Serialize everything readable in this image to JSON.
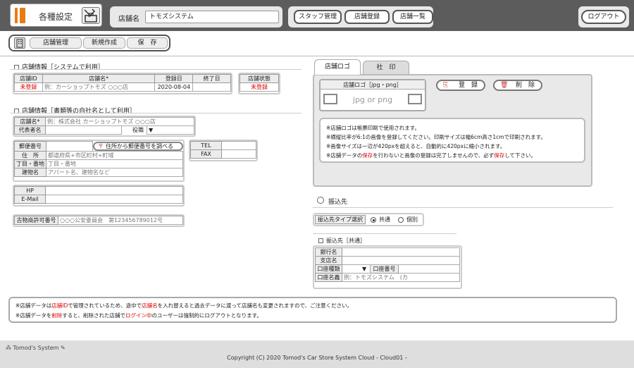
{
  "header": {
    "title": "各種設定",
    "store_label": "店舗名",
    "store_value": "トモズシステム",
    "nav": [
      "スタッフ管理",
      "店舗登録",
      "店舗一覧"
    ],
    "logout": "ログアウト"
  },
  "toolbar": {
    "items": [
      "店舗管理",
      "新規作成",
      "保　存"
    ]
  },
  "sys_info": {
    "title": "店舗情報［システムで利用］",
    "headers": [
      "店舗ID",
      "店舗名*",
      "登録日",
      "終了日"
    ],
    "values": [
      "未登録",
      "例：カーショップトモズ ○○○店",
      "2020-08-04",
      ""
    ],
    "status_header": "店舗状態",
    "status_value": "未登録"
  },
  "doc_info": {
    "title": "店舗情報［書類等の自社名として利用］",
    "store_name_label": "店舗名*",
    "store_name_placeholder": "例：株式会社 カーショップトモズ ○○○店",
    "rep_label": "代表者名",
    "role_label": "役職",
    "role_arrow": "▼",
    "zip_label": "郵便番号",
    "zip_button": "住所から郵便番号を調べる",
    "pref_label": "住　所",
    "pref_placeholder": "都道府県+市区町村+町域",
    "street_label": "丁目・番地",
    "street_placeholder": "丁目・番地",
    "bldg_label": "建物名",
    "bldg_placeholder": "アパート名、建物名など",
    "tel_label": "TEL",
    "fax_label": "FAX",
    "hp_label": "HP",
    "email_label": "E-Mail",
    "antique_label": "古物商許可番号",
    "antique_placeholder": "○○○公安委員会　第123456789012号"
  },
  "logo_panel": {
    "tabs": [
      "店舗ロゴ",
      "社　印"
    ],
    "upload_label": "店舗ロゴ［jpg・png］",
    "upload_placeholder": "jpg or png",
    "register_button": "登　録",
    "delete_button": "削　除",
    "notes": [
      "※店舗ロゴは帳票印刷で使用されます。",
      "※横縦比率が6:1の画像を登録してください。印刷サイズは幅6cm高さ1cmで印刷されます。",
      "※画像サイズは一辺が420pxを超えると、自動的に420pxに縮小されます。",
      [
        "※店舗データの",
        "保存",
        "を行わないと画像の登録は完了しませんので、必ず",
        "保存",
        "して下さい。"
      ]
    ]
  },
  "bank": {
    "title": "振込先",
    "type_label": "振込先タイプ選択",
    "options": [
      "共通",
      "個別"
    ],
    "selected": "共通",
    "section_title": "振込先［共通］",
    "bank_label": "銀行名",
    "branch_label": "支店名",
    "type_row_label": "口座種類",
    "type_arrow": "▼",
    "number_label": "口座番号",
    "holder_label": "口座名義",
    "holder_placeholder": "例：トモズシステム　(カ"
  },
  "bottom_notes": [
    [
      "※店舗データは",
      "店舗ID",
      "で管理されているため、途中で",
      "店舗名",
      "を入れ替えると過去データに渡って店舗名も変更されますので、ご注意ください。"
    ],
    [
      "※店舗データを",
      "削除",
      "すると、削除された店舗で",
      "ログイン中",
      "のユーザーは強制的にログアウトとなります。"
    ]
  ],
  "footer": {
    "brand": "Tomod's System",
    "copyright": "Copyright (C) 2020 Tomod's Car Store System Cloud - Cloud01 -"
  },
  "colors": {
    "accent": "#e87c14",
    "header_bg": "#5c5c5c",
    "warning": "#dd0000"
  }
}
